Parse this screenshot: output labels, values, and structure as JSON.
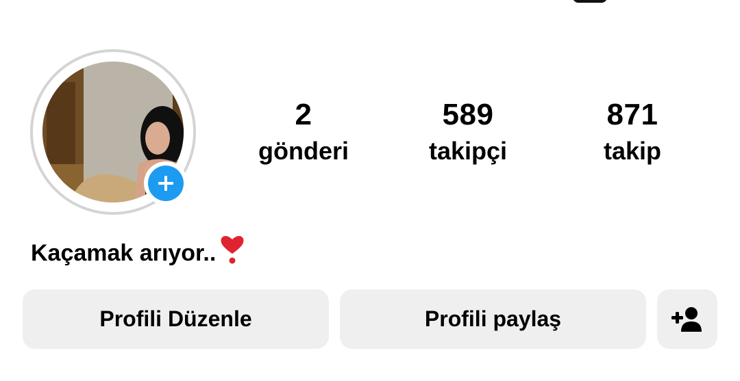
{
  "profile": {
    "avatar_icon": "profile-photo",
    "add_story_icon": "plus-icon",
    "stats": {
      "posts": {
        "value": "2",
        "label": "gönderi"
      },
      "followers": {
        "value": "589",
        "label": "takipçi"
      },
      "following": {
        "value": "871",
        "label": "takip"
      }
    },
    "bio": {
      "text": "Kaçamak arıyor..",
      "emoji_icon": "heavy-heart-exclamation-icon"
    }
  },
  "actions": {
    "edit_profile_label": "Profili Düzenle",
    "share_profile_label": "Profili paylaş",
    "discover_people_icon": "add-person-icon"
  },
  "colors": {
    "accent_blue": "#1d9bf0",
    "button_bg": "#efefef",
    "ring": "#d4d4d4",
    "heart_red": "#e0242f"
  }
}
